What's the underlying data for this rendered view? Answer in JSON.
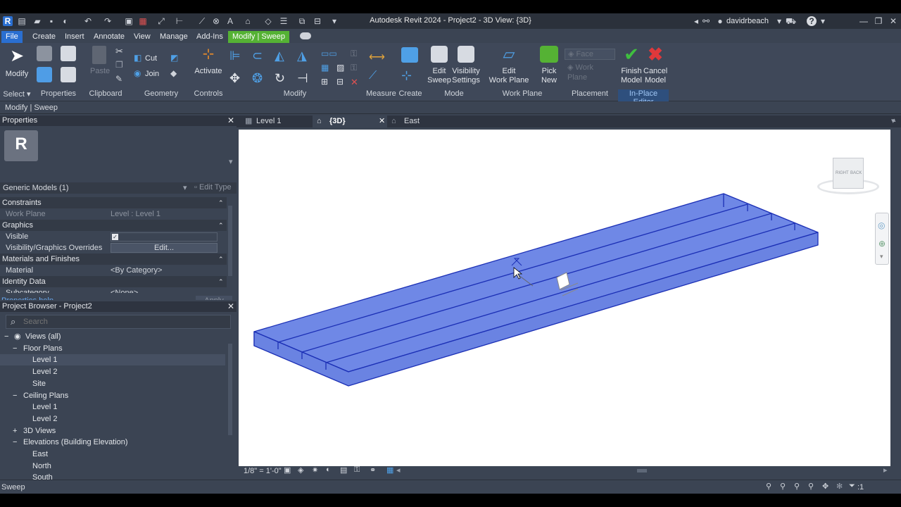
{
  "titlebar": {
    "title": "Autodesk Revit 2024 - Project2 - 3D View: {3D}",
    "user": "davidrbeach"
  },
  "menu": {
    "file": "File",
    "tabs": [
      "Create",
      "Insert",
      "Annotate",
      "View",
      "Manage",
      "Add-Ins"
    ],
    "context_tab": "Modify | Sweep"
  },
  "ribbon": {
    "modify": "Modify",
    "paste": "Paste",
    "cut": "Cut",
    "join": "Join",
    "activate": "Activate",
    "edit_sweep_1": "Edit",
    "edit_sweep_2": "Sweep",
    "vis_1": "Visibility",
    "vis_2": "Settings",
    "edit_wp_1": "Edit",
    "edit_wp_2": "Work Plane",
    "pick_1": "Pick",
    "pick_2": "New",
    "face": "Face",
    "work_plane": "Work Plane",
    "finish_1": "Finish",
    "finish_2": "Model",
    "cancel_1": "Cancel",
    "cancel_2": "Model",
    "panels": {
      "select": "Select",
      "properties": "Properties",
      "clipboard": "Clipboard",
      "geometry": "Geometry",
      "controls": "Controls",
      "modify": "Modify",
      "measure": "Measure",
      "create": "Create",
      "mode": "Mode",
      "work_plane": "Work Plane",
      "placement": "Placement",
      "in_place_editor": "In-Place Editor"
    }
  },
  "optionsbar": {
    "text": "Modify | Sweep"
  },
  "properties": {
    "header": "Properties",
    "type_selector": "Generic Models (1)",
    "edit_type": "Edit Type",
    "rows": [
      {
        "kind": "cat",
        "label": "Constraints"
      },
      {
        "kind": "row",
        "label": "Work Plane",
        "value": "Level : Level 1",
        "dim": true
      },
      {
        "kind": "cat",
        "label": "Graphics"
      },
      {
        "kind": "row",
        "label": "Visible",
        "value": "",
        "check": true
      },
      {
        "kind": "row",
        "label": "Visibility/Graphics Overrides",
        "value": "Edit...",
        "button": true
      },
      {
        "kind": "cat",
        "label": "Materials and Finishes"
      },
      {
        "kind": "row",
        "label": "Material",
        "value": "<By Category>"
      },
      {
        "kind": "cat",
        "label": "Identity Data"
      },
      {
        "kind": "row",
        "label": "Subcategory",
        "value": "<None>"
      }
    ],
    "help": "Properties help",
    "apply": "Apply"
  },
  "browser": {
    "header": "Project Browser - Project2",
    "search_placeholder": "Search",
    "items": [
      {
        "label": "Views (all)",
        "level": 0,
        "exp": "−"
      },
      {
        "label": "Floor Plans",
        "level": 1,
        "exp": "−"
      },
      {
        "label": "Level 1",
        "level": 2,
        "selected": true
      },
      {
        "label": "Level 2",
        "level": 2
      },
      {
        "label": "Site",
        "level": 2
      },
      {
        "label": "Ceiling Plans",
        "level": 1,
        "exp": "−"
      },
      {
        "label": "Level 1",
        "level": 2
      },
      {
        "label": "Level 2",
        "level": 2
      },
      {
        "label": "3D Views",
        "level": 1,
        "exp": "+"
      },
      {
        "label": "Elevations (Building Elevation)",
        "level": 1,
        "exp": "−"
      },
      {
        "label": "East",
        "level": 2
      },
      {
        "label": "North",
        "level": 2
      },
      {
        "label": "South",
        "level": 2
      }
    ]
  },
  "viewtabs": [
    {
      "label": "Level 1",
      "active": false
    },
    {
      "label": "{3D}",
      "active": true
    },
    {
      "label": "East",
      "active": false
    }
  ],
  "viewcube": {
    "left": "RIGHT",
    "right": "BACK"
  },
  "viewbar": {
    "scale": "1/8\" = 1'-0\""
  },
  "status": {
    "text": "Sweep",
    "filter_count": ":1"
  },
  "colors": {
    "accent_blue": "#2a6fd1",
    "context_green": "#55b234",
    "model_fill": "#6f88e6",
    "model_edge": "#1b2fb5"
  }
}
